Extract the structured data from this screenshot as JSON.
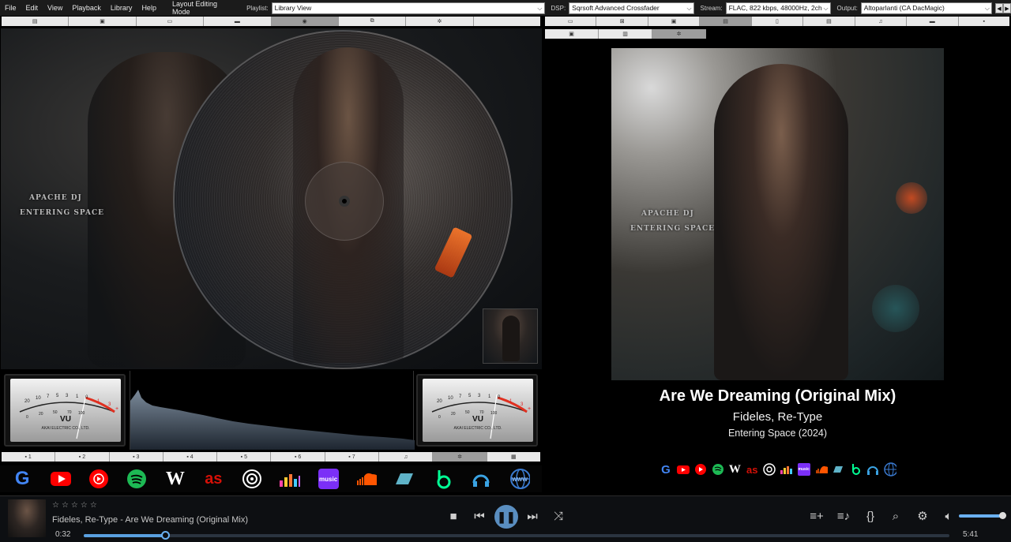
{
  "menu": [
    "File",
    "Edit",
    "View",
    "Playback",
    "Library",
    "Help"
  ],
  "layout_mode": "Layout Editing Mode",
  "playlist": {
    "label": "Playlist:",
    "value": "Library View"
  },
  "dsp": {
    "label": "DSP:",
    "value": "Sqrsoft Advanced Crossfader"
  },
  "stream": {
    "label": "Stream:",
    "value": "FLAC, 822 kbps, 48000Hz, 2ch"
  },
  "output": {
    "label": "Output:",
    "value": "Altoparlanti (CA DacMagic)"
  },
  "cover_text": {
    "line1": "APACHE DJ",
    "line2": "ENTERING SPACE"
  },
  "vu": {
    "label": "VU",
    "brand": "AKAI ELECTRIC CO., LTD.",
    "scale": [
      "20",
      "10",
      "7",
      "5",
      "3",
      "1",
      "0",
      "1",
      "3",
      "+"
    ],
    "scale_bottom": [
      "0",
      "20",
      "50",
      "70",
      "100"
    ]
  },
  "preset_tabs": [
    "1",
    "2",
    "3",
    "4",
    "5",
    "6",
    "7"
  ],
  "services": [
    "google",
    "youtube",
    "youtube-music",
    "spotify",
    "wikipedia",
    "lastfm",
    "discogs",
    "deezer",
    "amazon-music",
    "soundcloud",
    "tidal",
    "beatport",
    "qobuz",
    "www"
  ],
  "track": {
    "title": "Are We Dreaming (Original Mix)",
    "artist": "Fideles, Re-Type",
    "album": "Entering Space (2024)",
    "now_playing": "Fideles, Re-Type - Are We Dreaming (Original Mix)",
    "stars": "☆☆☆☆☆",
    "elapsed": "0:32",
    "duration": "5:41",
    "progress": 0.094,
    "volume": 0.9
  },
  "colors": {
    "accent": "#5aa0e0",
    "google": "#4285F4",
    "youtube": "#FF0000",
    "spotify": "#1DB954",
    "lastfm": "#D51007",
    "amazon": "#7B2FF7",
    "soundcloud": "#FF5500",
    "tidal": "#5fb3c8",
    "beatport": "#01FF95",
    "qobuz": "#3aa3e3"
  }
}
